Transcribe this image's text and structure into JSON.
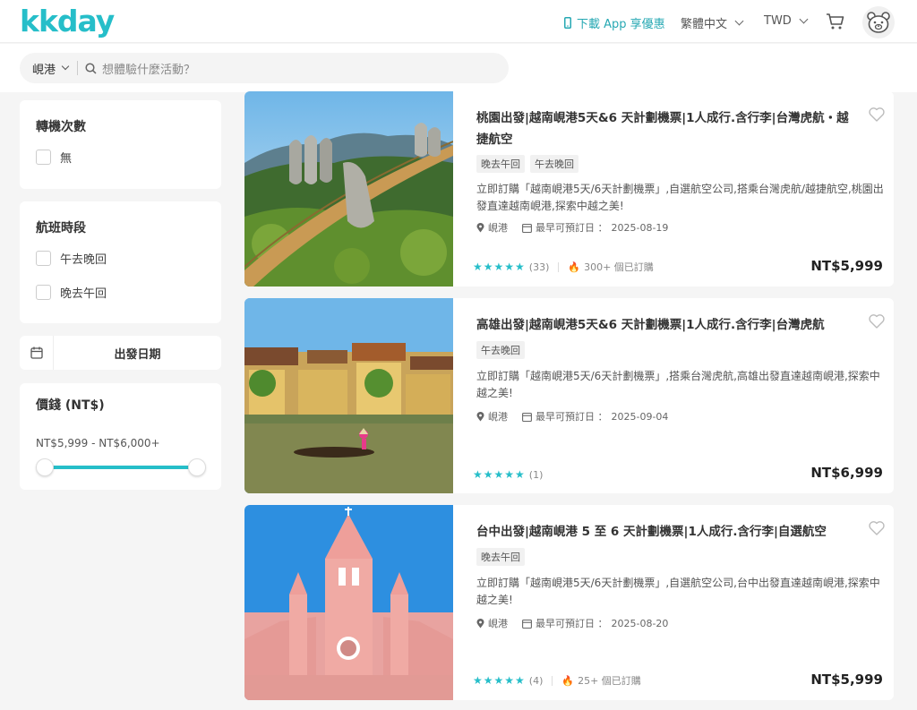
{
  "header": {
    "logo": "kkday",
    "app_download": "下載 App 享優惠",
    "language": "繁體中文",
    "currency": "TWD"
  },
  "search": {
    "location": "峴港",
    "placeholder": "想體驗什麼活動？"
  },
  "filters": {
    "transfers": {
      "title": "轉機次數",
      "options": [
        "無"
      ]
    },
    "flight_time": {
      "title": "航班時段",
      "options": [
        "午去晚回",
        "晚去午回"
      ]
    },
    "date": {
      "label": "出發日期"
    },
    "price": {
      "title": "價錢 (NT$)",
      "range": "NT$5,999 - NT$6,000+",
      "min_fraction": 0,
      "max_fraction": 1
    }
  },
  "products": [
    {
      "title": "桃園出發|越南峴港5天&6 天計劃機票|1人成行.含行李|台灣虎航・越捷航空",
      "tags": [
        "晚去午回",
        "午去晚回"
      ],
      "desc": "立即訂購「越南峴港5天/6天計劃機票」,自選航空公司,搭乘台灣虎航/越捷航空,桃園出發直達越南峴港,探索中越之美!",
      "location": "峴港",
      "date_label": "最早可預訂日 ：",
      "date": "2025-08-19",
      "stars": 5,
      "reviews": "(33)",
      "booked": "300+ 個已訂購",
      "price": "NT$5,999"
    },
    {
      "title": "高雄出發|越南峴港5天&6 天計劃機票|1人成行.含行李|台灣虎航",
      "tags": [
        "午去晚回"
      ],
      "desc": "立即訂購「越南峴港5天/6天計劃機票」,搭乘台灣虎航,高雄出發直達越南峴港,探索中越之美!",
      "location": "峴港",
      "date_label": "最早可預訂日 ：",
      "date": "2025-09-04",
      "stars": 5,
      "reviews": "(1)",
      "booked": "",
      "price": "NT$6,999"
    },
    {
      "title": "台中出發|越南峴港 5 至 6 天計劃機票|1人成行.含行李|自選航空",
      "tags": [
        "晚去午回"
      ],
      "desc": "立即訂購「越南峴港5天/6天計劃機票」,自選航空公司,台中出發直達越南峴港,探索中越之美!",
      "location": "峴港",
      "date_label": "最早可預訂日 ：",
      "date": "2025-08-20",
      "stars": 5,
      "reviews": "(4)",
      "booked": "25+ 個已訂購",
      "price": "NT$5,999"
    }
  ],
  "colors": {
    "brand": "#26bec9",
    "star": "#26bec9",
    "fire": "#f5a623"
  },
  "icons": [
    "phone-icon",
    "chevron-down-icon",
    "cart-icon",
    "bear-avatar-icon",
    "search-icon",
    "calendar-icon",
    "heart-icon",
    "location-pin-icon",
    "star-icon",
    "fire-icon"
  ]
}
